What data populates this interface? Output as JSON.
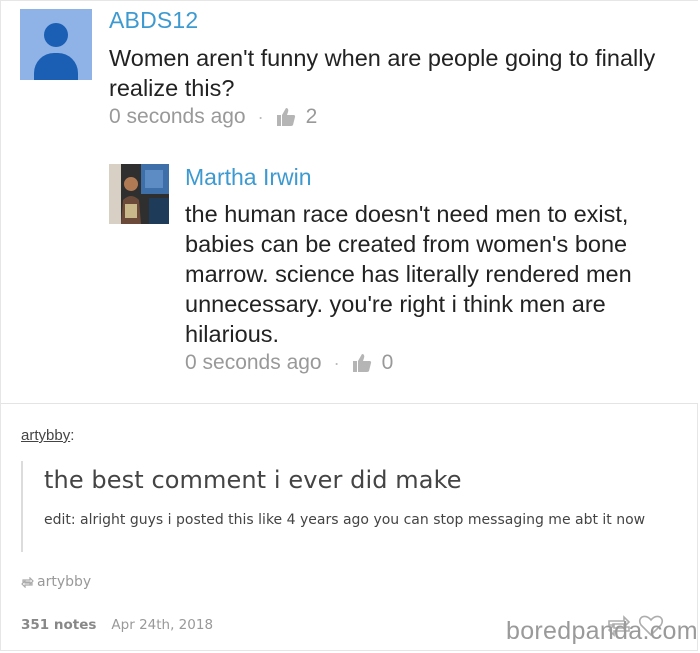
{
  "screenshot": {
    "comment1": {
      "username": "ABDS12",
      "text": "Women aren't funny when are people going to finally realize this?",
      "time": "0 seconds ago",
      "likes": "2"
    },
    "comment2": {
      "username": "Martha Irwin",
      "text": "the human race doesn't need men to exist, babies can be created from women's bone marrow. science has literally rendered men unnecessary. you're right i think men are hilarious.",
      "time": "0 seconds ago",
      "likes": "0"
    },
    "separator": "·"
  },
  "post": {
    "author": "artybby",
    "author_suffix": ":",
    "quote_main": "the best comment i ever did make",
    "quote_edit": "edit: alright guys i posted this like 4 years ago you can stop messaging me abt it now",
    "reblogged_from": "artybby",
    "notes": "351 notes",
    "date": "Apr 24th, 2018"
  },
  "watermark": "boredpanda.com",
  "colors": {
    "username": "#3d9ad1",
    "avatar_bg": "#8fb3e6",
    "avatar_fg": "#1a5fb4",
    "meta_gray": "#999999"
  },
  "icons": {
    "like": "thumbs-up-icon",
    "reblog": "reblog-icon",
    "heart": "heart-icon"
  }
}
